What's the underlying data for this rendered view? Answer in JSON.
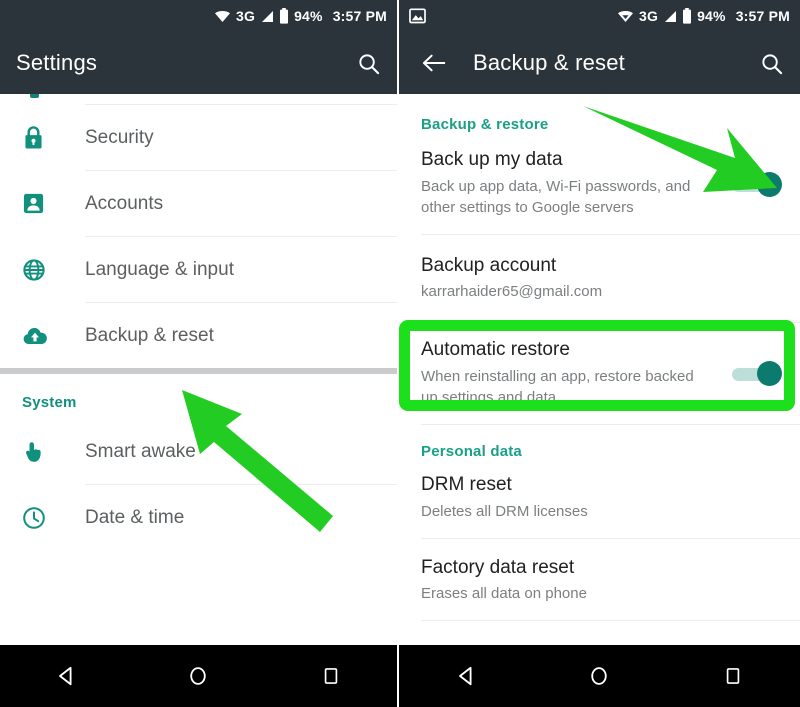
{
  "left_panel": {
    "status_bar": {
      "wifi_icon": "wifi-icon",
      "network_label": "3G",
      "signal_icon": "signal-bars-icon",
      "battery_icon": "battery-icon",
      "battery_label": "94%",
      "clock_label": "3:57 PM"
    },
    "app_bar": {
      "title": "Settings",
      "search_icon": "search-icon"
    },
    "items": [
      {
        "label": "Security",
        "icon": "lock-icon"
      },
      {
        "label": "Accounts",
        "icon": "person-badge-icon"
      },
      {
        "label": "Language & input",
        "icon": "globe-icon"
      },
      {
        "label": "Backup & reset",
        "icon": "cloud-upload-icon"
      }
    ],
    "system_section": {
      "header": "System",
      "items": [
        {
          "label": "Smart awake",
          "icon": "pointing-hand-icon"
        },
        {
          "label": "Date & time",
          "icon": "clock-icon"
        }
      ]
    },
    "nav_bar": {
      "back_icon": "back-triangle-icon",
      "home_icon": "home-circle-icon",
      "recents_icon": "recents-square-icon"
    }
  },
  "right_panel": {
    "status_bar": {
      "notification_icon": "screenshot-image-icon",
      "wifi_icon": "wifi-icon",
      "network_label": "3G",
      "signal_icon": "signal-bars-icon",
      "battery_icon": "battery-icon",
      "battery_label": "94%",
      "clock_label": "3:57 PM"
    },
    "app_bar": {
      "back_icon": "arrow-back-icon",
      "title": "Backup & reset",
      "search_icon": "search-icon"
    },
    "backup_restore": {
      "header": "Backup & restore",
      "back_up_my_data": {
        "title": "Back up my data",
        "summary": "Back up app data, Wi-Fi passwords, and other settings to Google servers",
        "toggle_state": "on"
      },
      "backup_account": {
        "title": "Backup account",
        "summary": "karrarhaider65@gmail.com"
      },
      "automatic_restore": {
        "title": "Automatic restore",
        "summary": "When reinstalling an app, restore backed up settings and data",
        "toggle_state": "on"
      }
    },
    "personal_data": {
      "header": "Personal data",
      "drm_reset": {
        "title": "DRM reset",
        "summary": "Deletes all DRM licenses"
      },
      "factory_data_reset": {
        "title": "Factory data reset",
        "summary": "Erases all data on phone"
      }
    },
    "nav_bar": {
      "back_icon": "back-triangle-icon",
      "home_icon": "home-circle-icon",
      "recents_icon": "recents-square-icon"
    }
  },
  "annotations": {
    "highlight_color": "#1ce01c",
    "arrow_color": "#22cc22",
    "arrow_left": "arrow-pointing-to-backup-and-reset",
    "arrow_right": "arrow-pointing-to-back-up-my-data-toggle",
    "highlight_box": "highlight-backup-account-row"
  },
  "theme": {
    "appbar_bg": "#2b343b",
    "accent_teal": "#12907e",
    "toggle_on": "#0c7b6d",
    "navbar_bg": "#000000"
  }
}
